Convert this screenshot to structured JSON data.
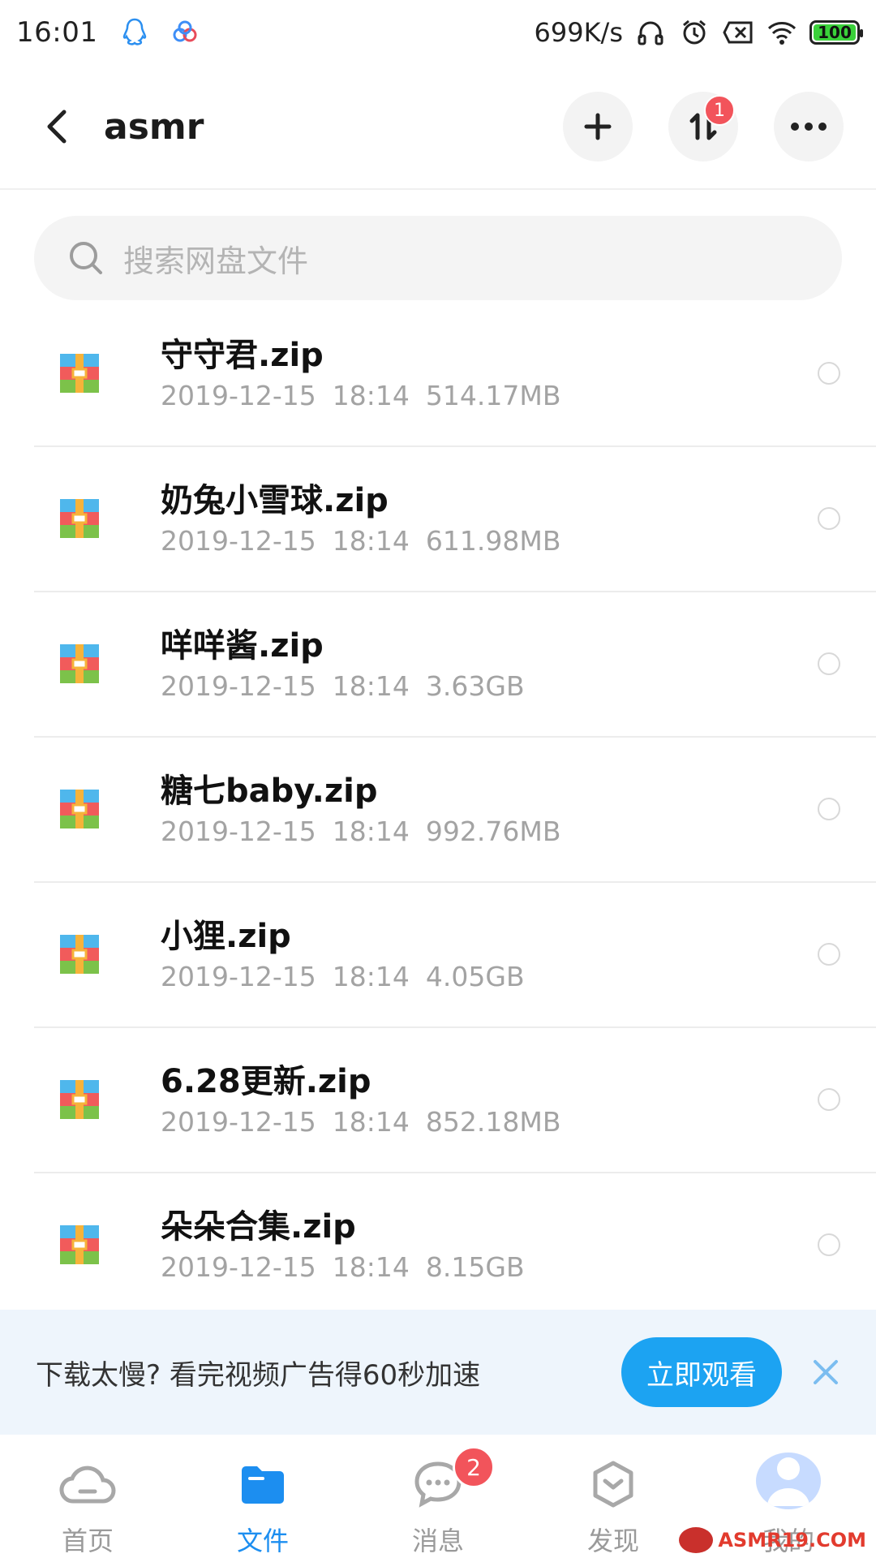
{
  "status_bar": {
    "time": "16:01",
    "net_speed": "699K/s",
    "battery": "100",
    "icons": [
      "qq-icon",
      "baidu-cloud-icon",
      "headphones-icon",
      "alarm-icon",
      "sim-off-icon",
      "wifi-icon",
      "battery-icon"
    ]
  },
  "header": {
    "title": "asmr",
    "transfer_badge": "1"
  },
  "search": {
    "placeholder": "搜索网盘文件"
  },
  "files": [
    {
      "name": "守守君.zip",
      "date": "2019-12-15",
      "time": "18:14",
      "size": "514.17MB"
    },
    {
      "name": "奶兔小雪球.zip",
      "date": "2019-12-15",
      "time": "18:14",
      "size": "611.98MB"
    },
    {
      "name": "咩咩酱.zip",
      "date": "2019-12-15",
      "time": "18:14",
      "size": "3.63GB"
    },
    {
      "name": "糖七baby.zip",
      "date": "2019-12-15",
      "time": "18:14",
      "size": "992.76MB"
    },
    {
      "name": "小狸.zip",
      "date": "2019-12-15",
      "time": "18:14",
      "size": "4.05GB"
    },
    {
      "name": "6.28更新.zip",
      "date": "2019-12-15",
      "time": "18:14",
      "size": "852.18MB"
    },
    {
      "name": "朵朵合集.zip",
      "date": "2019-12-15",
      "time": "18:14",
      "size": "8.15GB"
    }
  ],
  "ad": {
    "text": "下载太慢? 看完视频广告得60秒加速",
    "button": "立即观看"
  },
  "nav": {
    "items": [
      {
        "label": "首页",
        "icon": "cloud-icon"
      },
      {
        "label": "文件",
        "icon": "folder-icon"
      },
      {
        "label": "消息",
        "icon": "chat-icon",
        "badge": "2"
      },
      {
        "label": "发现",
        "icon": "hexagon-icon"
      },
      {
        "label": "我的",
        "icon": "avatar-icon"
      }
    ]
  },
  "watermark": "ASMR19.COM",
  "colors": {
    "accent": "#1c8ef0",
    "ad_button": "#1ca3f2",
    "badge": "#f2545b"
  }
}
